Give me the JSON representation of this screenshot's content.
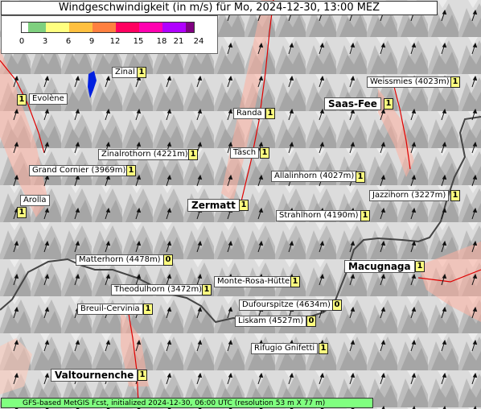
{
  "title": "Windgeschwindigkeit (in m/s) für Mo, 2024-12-30, 13:00 MEZ",
  "legend": {
    "ticks": [
      "0",
      "3",
      "6",
      "9",
      "12",
      "15",
      "18",
      "21",
      "24"
    ],
    "colors": [
      "#ffffff",
      "#7fd07f",
      "#ffff80",
      "#ffc040",
      "#ff8040",
      "#ff0060",
      "#ff00b0",
      "#b000ff",
      "#800080"
    ]
  },
  "places": [
    {
      "name": "Zinal",
      "value": "1"
    },
    {
      "name": "Evolène",
      "value": "1"
    },
    {
      "name": "Weissmies (4023m)",
      "value": "1"
    },
    {
      "name": "Saas-Fee",
      "value": "1"
    },
    {
      "name": "Randa",
      "value": "1"
    },
    {
      "name": "Täsch",
      "value": "1"
    },
    {
      "name": "Zinalrothorn (4221m)",
      "value": "1"
    },
    {
      "name": "Grand Cornier (3969m)",
      "value": "1"
    },
    {
      "name": "Allalinhorn (4027m)",
      "value": "1"
    },
    {
      "name": "Jazzihorn (3227m)",
      "value": "1"
    },
    {
      "name": "Arolla",
      "value": "1"
    },
    {
      "name": "Zermatt",
      "value": "1"
    },
    {
      "name": "Strahlhorn (4190m)",
      "value": "1"
    },
    {
      "name": "Matterhorn (4478m)",
      "value": "0"
    },
    {
      "name": "Macugnaga",
      "value": "1"
    },
    {
      "name": "Monte-Rosa-Hütte",
      "value": "1"
    },
    {
      "name": "Theodulhorn (3472m)",
      "value": "1"
    },
    {
      "name": "Dufourspitze (4634m)",
      "value": "0"
    },
    {
      "name": "Breuil-Cervinia",
      "value": "1"
    },
    {
      "name": "Liskam (4527m)",
      "value": "0"
    },
    {
      "name": "Rifugio Gnifetti",
      "value": "1"
    },
    {
      "name": "Valtournenche",
      "value": "1"
    }
  ],
  "footer": "GFS-based MetGIS Fcst, initialized 2024-12-30, 06:00 UTC  (resolution 53 m X 77 m)"
}
